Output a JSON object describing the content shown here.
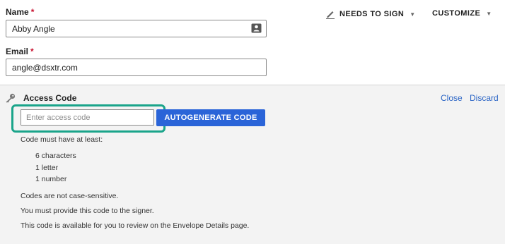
{
  "recipient": {
    "name_label": "Name",
    "name_value": "Abby Angle",
    "email_label": "Email",
    "email_value": "angle@dsxtr.com",
    "required_mark": "*"
  },
  "actions": {
    "needs_to_sign": "NEEDS TO SIGN",
    "customize": "CUSTOMIZE",
    "caret": "▼"
  },
  "access_code": {
    "title": "Access Code",
    "close_label": "Close",
    "discard_label": "Discard",
    "input_placeholder": "Enter access code",
    "input_value": "",
    "autogenerate_label": "AUTOGENERATE CODE",
    "requirements_intro": "Code must have at least:",
    "requirements": [
      "6 characters",
      "1 letter",
      "1 number"
    ],
    "notes": [
      "Codes are not case-sensitive.",
      "You must provide this code to the signer.",
      "This code is available for you to review on the Envelope Details page."
    ]
  },
  "colors": {
    "accent_blue": "#2a64d8",
    "link_blue": "#2a64c5",
    "highlight_teal": "#1aa48a",
    "required_red": "#c8102e"
  },
  "icons": [
    "contact-card-icon",
    "pen-icon",
    "caret-down-icon",
    "key-icon"
  ]
}
